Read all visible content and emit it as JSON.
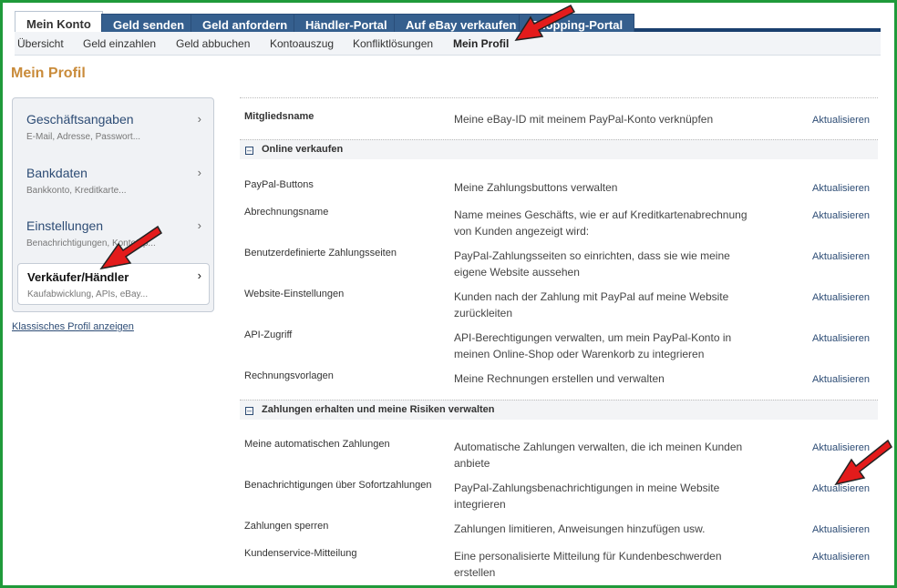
{
  "tabs": [
    "Mein Konto",
    "Geld senden",
    "Geld anfordern",
    "Händler-Portal",
    "Auf eBay verkaufen",
    "Shopping-Portal"
  ],
  "subnav": [
    "Übersicht",
    "Geld einzahlen",
    "Geld abbuchen",
    "Kontoauszug",
    "Konfliktlösungen",
    "Mein Profil"
  ],
  "page_title": "Mein Profil",
  "sidebar": [
    {
      "title": "Geschäftsangaben",
      "sub": "E-Mail, Adresse, Passwort..."
    },
    {
      "title": "Bankdaten",
      "sub": "Bankkonto, Kreditkarte..."
    },
    {
      "title": "Einstellungen",
      "sub": "Benachrichtigungen, Kontotyp..."
    },
    {
      "title": "Verkäufer/Händler",
      "sub": "Kaufabwicklung, APIs, eBay..."
    }
  ],
  "chevron": "›",
  "classic_link": "Klassisches Profil anzeigen",
  "action_label": "Aktualisieren",
  "top_row": {
    "label": "Mitgliedsname",
    "desc": "Meine eBay-ID mit meinem PayPal-Konto verknüpfen"
  },
  "section1": {
    "title": "Online verkaufen",
    "rows": [
      {
        "label": "PayPal-Buttons",
        "desc": "Meine Zahlungsbuttons verwalten"
      },
      {
        "label": "Abrechnungsname",
        "desc": "Name meines Geschäfts, wie er auf Kreditkartenabrechnung von Kunden angezeigt wird:"
      },
      {
        "label": "Benutzerdefinierte Zahlungsseiten",
        "desc": "PayPal-Zahlungsseiten so einrichten, dass sie wie meine eigene Website aussehen"
      },
      {
        "label": "Website-Einstellungen",
        "desc": "Kunden nach der Zahlung mit PayPal auf meine Website zurückleiten"
      },
      {
        "label": "API-Zugriff",
        "desc": "API-Berechtigungen verwalten, um mein PayPal-Konto in meinen Online-Shop oder Warenkorb zu integrieren"
      },
      {
        "label": "Rechnungsvorlagen",
        "desc": "Meine Rechnungen erstellen und verwalten"
      }
    ]
  },
  "section2": {
    "title": "Zahlungen erhalten und meine Risiken verwalten",
    "rows": [
      {
        "label": "Meine automatischen Zahlungen",
        "desc": "Automatische Zahlungen verwalten, die ich meinen Kunden anbiete"
      },
      {
        "label": "Benachrichtigungen über Sofortzahlungen",
        "desc": "PayPal-Zahlungsbenachrichtigungen in meine Website integrieren"
      },
      {
        "label": "Zahlungen sperren",
        "desc": "Zahlungen limitieren, Anweisungen hinzufügen usw."
      },
      {
        "label": "Kundenservice-Mitteilung",
        "desc": "Eine personalisierte Mitteilung für Kundenbeschwerden erstellen"
      }
    ]
  },
  "colors": {
    "frame": "#1f9a3a",
    "tab": "#355f8e",
    "title": "#c98b3a",
    "arrow": "#e31b1b"
  }
}
